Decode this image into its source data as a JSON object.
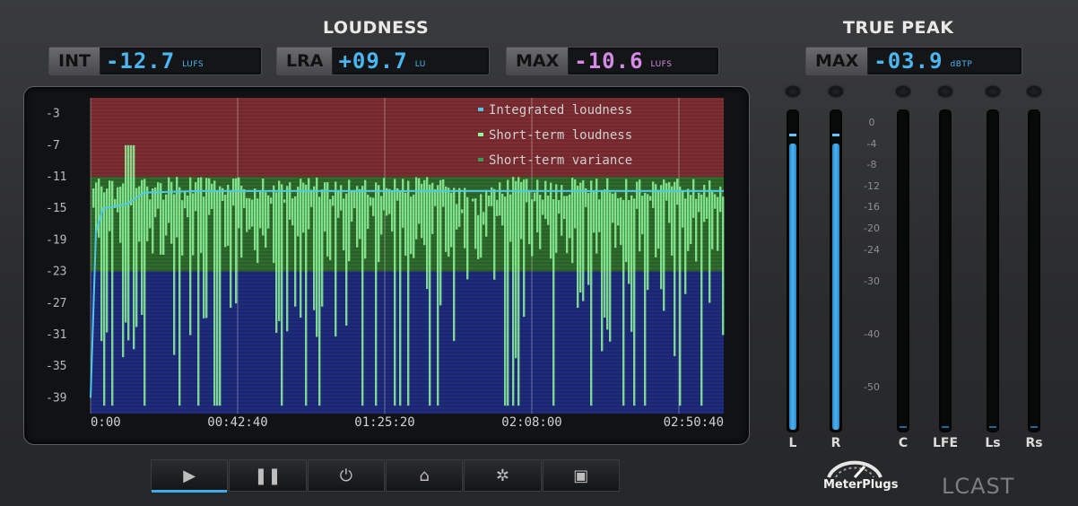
{
  "loudness": {
    "title": "LOUDNESS",
    "int": {
      "label": "INT",
      "value": "-12.7",
      "unit": "LUFS"
    },
    "lra": {
      "label": "LRA",
      "value": "+09.7",
      "unit": "LU"
    },
    "max": {
      "label": "MAX",
      "value": "-10.6",
      "unit": "LUFS"
    }
  },
  "true_peak": {
    "title": "TRUE PEAK",
    "max": {
      "label": "MAX",
      "value": "-03.9",
      "unit": "dBTP"
    }
  },
  "graph": {
    "legend": [
      "Integrated loudness",
      "Short-term loudness",
      "Short-term variance"
    ],
    "legend_colors": [
      "#4fc9ea",
      "#8ef59a",
      "#3b9c5a"
    ],
    "zone_colors": {
      "loud": "#7e2e33",
      "ok": "#2f6b2d",
      "quiet": "#1f2b7c"
    },
    "y_ticks": [
      "-3",
      "-7",
      "-11",
      "-15",
      "-19",
      "-23",
      "-27",
      "-31",
      "-35",
      "-39"
    ],
    "x_ticks": [
      "0:00",
      "00:42:40",
      "01:25:20",
      "02:08:00",
      "02:50:40"
    ]
  },
  "meters": {
    "channels": [
      {
        "label": "L",
        "level_db": -6,
        "peak_db": -4
      },
      {
        "label": "R",
        "level_db": -6,
        "peak_db": -4
      },
      {
        "label": "C",
        "level_db": null,
        "peak_db": null
      },
      {
        "label": "LFE",
        "level_db": null,
        "peak_db": null
      },
      {
        "label": "Ls",
        "level_db": null,
        "peak_db": null
      },
      {
        "label": "Rs",
        "level_db": null,
        "peak_db": null
      }
    ],
    "scale": [
      "0",
      "-4",
      "-8",
      "-12",
      "-16",
      "-20",
      "-24",
      "-30",
      "-40",
      "-50"
    ]
  },
  "transport": [
    {
      "name": "play",
      "glyph": "▶"
    },
    {
      "name": "pause",
      "glyph": "❚❚"
    },
    {
      "name": "power",
      "glyph": "⏻"
    },
    {
      "name": "home",
      "glyph": "⌂"
    },
    {
      "name": "settings",
      "glyph": "✲"
    },
    {
      "name": "save",
      "glyph": "▣"
    }
  ],
  "branding": {
    "company": "MeterPlugs",
    "product": "LCAST"
  }
}
